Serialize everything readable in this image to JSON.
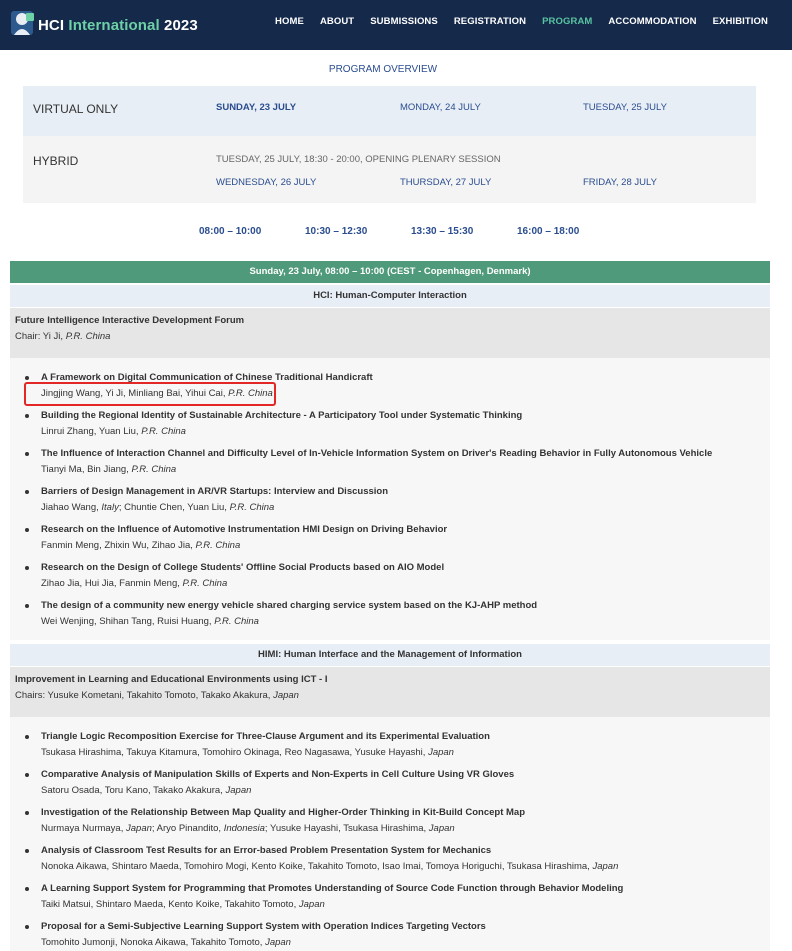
{
  "header": {
    "logo_prefix": "HCI",
    "logo_highlight": "International",
    "logo_year": "2023",
    "nav": [
      "HOME",
      "ABOUT",
      "SUBMISSIONS",
      "REGISTRATION",
      "PROGRAM",
      "ACCOMMODATION",
      "EXHIBITION"
    ],
    "active_nav": "PROGRAM",
    "colors": {
      "bar": "#15294a",
      "accent": "#58c4a0"
    }
  },
  "overview": {
    "title": "PROGRAM OVERVIEW",
    "virtual_label": "VIRTUAL ONLY",
    "virtual_days": [
      "SUNDAY, 23 JULY",
      "MONDAY, 24 JULY",
      "TUESDAY, 25 JULY"
    ],
    "hybrid_label": "HYBRID",
    "hybrid_note": "TUESDAY, 25 JULY, 18:30 - 20:00, OPENING PLENARY SESSION",
    "hybrid_days": [
      "WEDNESDAY, 26 JULY",
      "THURSDAY, 27 JULY",
      "FRIDAY, 28 JULY"
    ]
  },
  "time_slots": [
    "08:00 – 10:00",
    "10:30 – 12:30",
    "13:30 – 15:30",
    "16:00 – 18:00"
  ],
  "session_header": "Sunday, 23 July, 08:00 – 10:00 (CEST - Copenhagen, Denmark)",
  "tracks": [
    {
      "name": "HCI: Human-Computer Interaction",
      "forum_title": "Future Intelligence Interactive Development Forum",
      "chair_label": "Chair: Yi Ji, ",
      "chair_country": "P.R. China",
      "papers": [
        {
          "title": "A Framework on Digital Communication of Chinese Traditional Handicraft",
          "authors": "Jingjing Wang, Yi Ji, Minliang Bai, Yihui Cai, ",
          "country": "P.R. China"
        },
        {
          "title": "Building the Regional Identity of Sustainable Architecture - A Participatory Tool under Systematic Thinking",
          "authors": "Linrui Zhang, Yuan Liu, ",
          "country": "P.R. China"
        },
        {
          "title": "The Influence of Interaction Channel and Difficulty Level of In-Vehicle Information System on Driver's Reading Behavior in Fully Autonomous Vehicle",
          "authors": "Tianyi Ma, Bin Jiang, ",
          "country": "P.R. China"
        },
        {
          "title": "Barriers of Design Management in AR/VR Startups: Interview and Discussion",
          "authors": "Jiahao Wang, ",
          "country": "Italy",
          "authors2": "; Chuntie Chen, Yuan Liu, ",
          "country2": "P.R. China"
        },
        {
          "title": "Research on the Influence of Automotive Instrumentation HMI Design on Driving Behavior",
          "authors": "Fanmin Meng, Zhixin Wu, Zihao Jia, ",
          "country": "P.R. China"
        },
        {
          "title": "Research on the Design of College Students' Offline Social Products based on AIO Model",
          "authors": "Zihao Jia, Hui Jia, Fanmin Meng, ",
          "country": "P.R. China"
        },
        {
          "title": "The design of a community new energy vehicle shared charging service system based on the KJ-AHP method",
          "authors": "Wei Wenjing, Shihan Tang, Ruisi Huang, ",
          "country": "P.R. China"
        }
      ]
    },
    {
      "name": "HIMI: Human Interface and the Management of Information",
      "forum_title": "Improvement in Learning and Educational Environments using ICT - I",
      "chair_label": "Chairs: Yusuke Kometani, Takahito Tomoto, Takako Akakura, ",
      "chair_country": "Japan",
      "papers": [
        {
          "title": "Triangle Logic Recomposition Exercise for Three-Clause Argument and its Experimental Evaluation",
          "authors": "Tsukasa Hirashima, Takuya Kitamura, Tomohiro Okinaga, Reo Nagasawa, Yusuke Hayashi, ",
          "country": "Japan"
        },
        {
          "title": "Comparative Analysis of Manipulation Skills of Experts and Non-Experts in Cell Culture Using VR Gloves",
          "authors": "Satoru Osada, Toru Kano, Takako Akakura, ",
          "country": "Japan"
        },
        {
          "title": "Investigation of the Relationship Between Map Quality and Higher-Order Thinking in Kit-Build Concept Map",
          "authors": "Nurmaya Nurmaya, ",
          "country": "Japan",
          "authors2": "; Aryo Pinandito, ",
          "country2": "Indonesia",
          "authors3": "; Yusuke Hayashi, Tsukasa Hirashima, ",
          "country3": "Japan"
        },
        {
          "title": "Analysis of Classroom Test Results for an Error-based Problem Presentation System for Mechanics",
          "authors": "Nonoka Aikawa, Shintaro Maeda, Tomohiro Mogi, Kento Koike, Takahito Tomoto, Isao Imai, Tomoya Horiguchi, Tsukasa Hirashima, ",
          "country": "Japan"
        },
        {
          "title": "A Learning Support System for Programming that Promotes Understanding of Source Code Function through Behavior Modeling",
          "authors": "Taiki Matsui, Shintaro Maeda, Kento Koike, Takahito Tomoto, ",
          "country": "Japan"
        },
        {
          "title": "Proposal for a Semi-Subjective Learning Support System with Operation Indices Targeting Vectors",
          "authors": "Tomohito Jumonji, Nonoka Aikawa, Takahito Tomoto, ",
          "country": "Japan"
        }
      ]
    }
  ]
}
